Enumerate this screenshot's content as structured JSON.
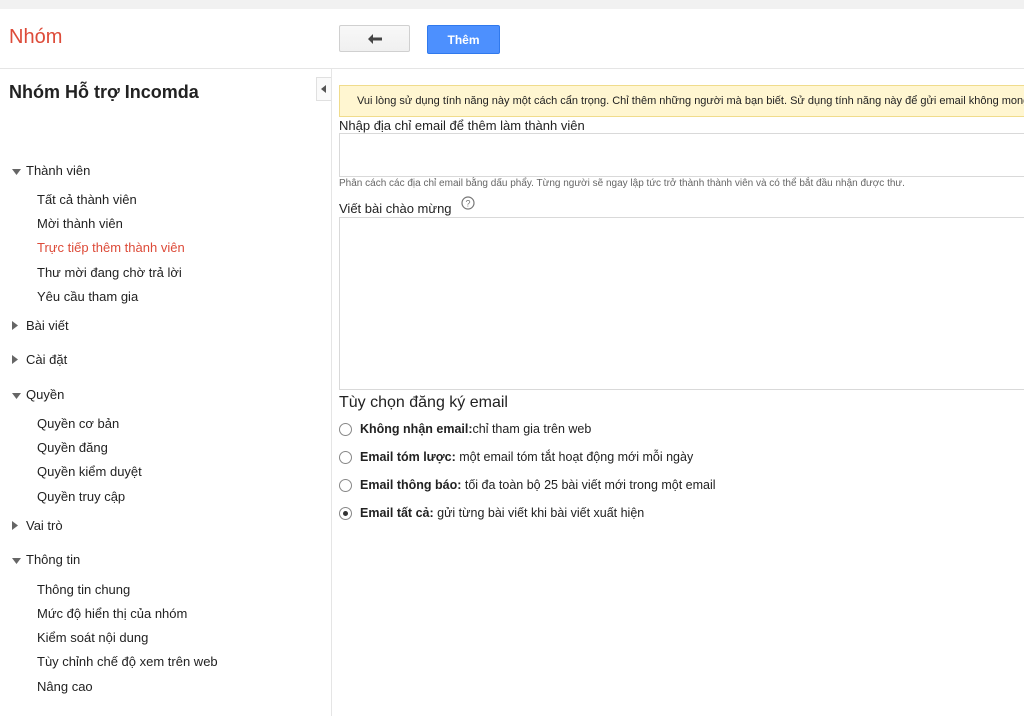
{
  "header": {
    "app_title": "Nhóm",
    "add_button": "Thêm"
  },
  "sidebar": {
    "group_name": "Nhóm Hỗ trợ Incomda",
    "sections": [
      {
        "label": "Thành viên",
        "expanded": true,
        "items": [
          "Tất cả thành viên",
          "Mời thành viên",
          "Trực tiếp thêm thành viên",
          "Thư mời đang chờ trả lời",
          "Yêu cầu tham gia"
        ]
      },
      {
        "label": "Bài viết",
        "expanded": false
      },
      {
        "label": "Cài đặt",
        "expanded": false
      },
      {
        "label": "Quyền",
        "expanded": true,
        "items": [
          "Quyền cơ bản",
          "Quyền đăng",
          "Quyền kiểm duyệt",
          "Quyền truy cập"
        ]
      },
      {
        "label": "Vai trò",
        "expanded": false
      },
      {
        "label": "Thông tin",
        "expanded": true,
        "items": [
          "Thông tin chung",
          "Mức độ hiển thị của nhóm",
          "Kiểm soát nội dung",
          "Tùy chỉnh chế độ xem trên web",
          "Nâng cao"
        ]
      }
    ],
    "active_item": "Trực tiếp thêm thành viên"
  },
  "main": {
    "notice": "Vui lòng sử dụng tính năng này một cách cẩn trọng. Chỉ thêm những người mà bạn biết. Sử dụng tính năng này để gửi email không mong",
    "email_label": "Nhập địa chỉ email để thêm làm thành viên",
    "email_value": "",
    "email_hint": "Phân cách các địa chỉ email bằng dấu phẩy. Từng người sẽ ngay lập tức trở thành thành viên và có thể bắt đầu nhận được thư.",
    "welcome_label": "Viết bài chào mừng",
    "welcome_value": "",
    "subscription_title": "Tùy chọn đăng ký email",
    "options": [
      {
        "bold": "Không nhận email:",
        "text": "chỉ tham gia trên web",
        "checked": false
      },
      {
        "bold": "Email tóm lược:",
        "text": " một email tóm tắt hoạt động mới mỗi ngày",
        "checked": false
      },
      {
        "bold": "Email thông báo:",
        "text": " tối đa toàn bộ 25 bài viết mới trong một email",
        "checked": false
      },
      {
        "bold": "Email tất cả:",
        "text": " gửi từng bài viết khi bài viết xuất hiện",
        "checked": true
      }
    ]
  },
  "colors": {
    "accent_red": "#dd4b39",
    "primary_blue": "#4d90fe",
    "notice_bg": "#fff6d1"
  },
  "icons": {
    "back": "back-arrow-icon",
    "collapse": "caret-left-icon",
    "help": "question-circle-icon"
  }
}
